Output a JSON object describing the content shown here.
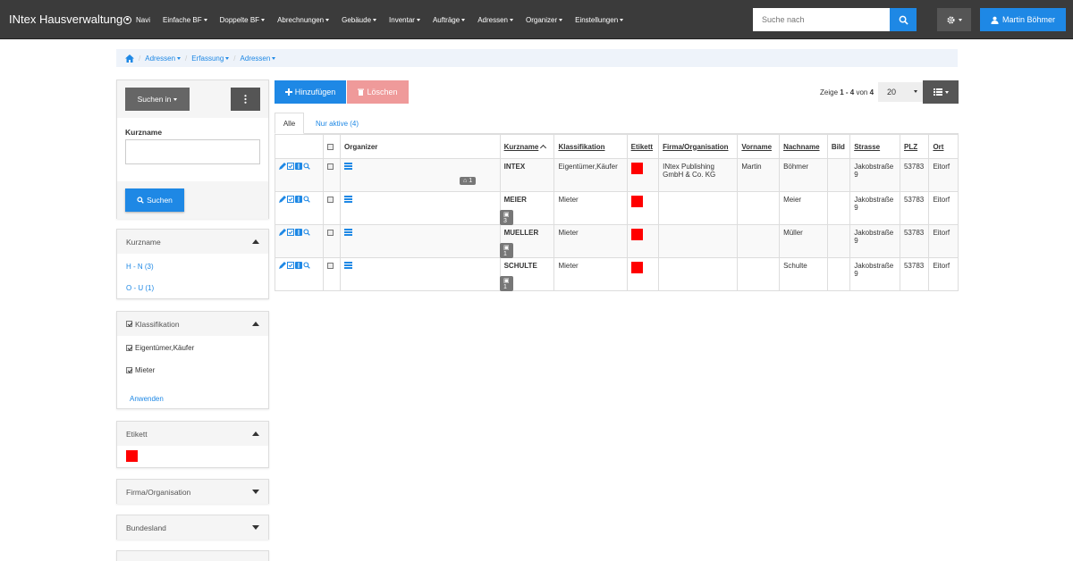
{
  "app": {
    "title": "INtex Hausverwaltung"
  },
  "nav": {
    "navi": "Navi",
    "items": [
      "Einfache BF",
      "Doppelte BF",
      "Abrechnungen",
      "Gebäude",
      "Inventar",
      "Aufträge",
      "Adressen",
      "Organizer",
      "Einstellungen"
    ]
  },
  "search": {
    "placeholder": "Suche nach"
  },
  "user": {
    "name": "Martin Böhmer"
  },
  "breadcrumb": [
    "Adressen",
    "Erfassung",
    "Adressen"
  ],
  "sidebar": {
    "search_in": "Suchen in",
    "kurzname_label": "Kurzname",
    "search_button": "Suchen",
    "facet_kurzname": {
      "title": "Kurzname",
      "items": [
        "H - N (3)",
        "O - U (1)"
      ]
    },
    "facet_klassifikation": {
      "title": "Klassifikation",
      "items": [
        "Eigentümer,Käufer",
        "Mieter"
      ],
      "apply": "Anwenden"
    },
    "facet_etikett": {
      "title": "Etikett",
      "color": "#ff0000"
    },
    "facet_firma": {
      "title": "Firma/Organisation"
    },
    "facet_bundesland": {
      "title": "Bundesland"
    }
  },
  "toolbar": {
    "add": "Hinzufügen",
    "delete": "Löschen",
    "zeige_prefix": "Zeige ",
    "zeige_range": "1 - 4",
    "zeige_mid": " von ",
    "zeige_total": "4",
    "page_size": "20"
  },
  "tabs": {
    "all": "Alle",
    "active": "Nur aktive (4)"
  },
  "table": {
    "headers": {
      "organizer": "Organizer",
      "kurzname": "Kurzname",
      "klassifikation": "Klassifikation",
      "etikett": "Etikett",
      "firma": "Firma/Organisation",
      "vorname": "Vorname",
      "nachname": "Nachname",
      "bild": "Bild",
      "strasse": "Strasse",
      "plz": "PLZ",
      "ort": "Ort"
    },
    "rows": [
      {
        "badge": "1",
        "badge_icon": "home",
        "kurzname": "INTEX",
        "klassifikation": "Eigentümer,Käufer",
        "firma": "INtex Publishing GmbH & Co. KG",
        "vorname": "Martin",
        "nachname": "Böhmer",
        "strasse": "Jakobstraße 9",
        "plz": "53783",
        "ort": "Eitorf"
      },
      {
        "badge": "3",
        "badge_icon": "lock",
        "kurzname": "MEIER",
        "klassifikation": "Mieter",
        "firma": "",
        "vorname": "",
        "nachname": "Meier",
        "strasse": "Jakobstraße 9",
        "plz": "53783",
        "ort": "Eitorf"
      },
      {
        "badge": "1",
        "badge_icon": "lock",
        "kurzname": "MUELLER",
        "klassifikation": "Mieter",
        "firma": "",
        "vorname": "",
        "nachname": "Müller",
        "strasse": "Jakobstraße 9",
        "plz": "53783",
        "ort": "Eitorf"
      },
      {
        "badge": "1",
        "badge_icon": "lock",
        "kurzname": "SCHULTE",
        "klassifikation": "Mieter",
        "firma": "",
        "vorname": "",
        "nachname": "Schulte",
        "strasse": "Jakobstraße 9",
        "plz": "53783",
        "ort": "Eitorf"
      }
    ]
  },
  "colors": {
    "navbar": "#3b3b3b",
    "primary": "#1e88e5",
    "danger_disabled": "#ef9a9a",
    "etikett": "#ff0000"
  }
}
